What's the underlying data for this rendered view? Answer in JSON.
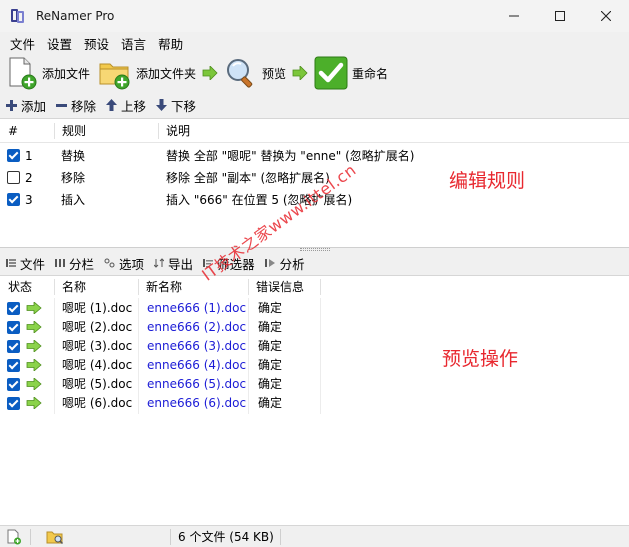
{
  "window": {
    "title": "ReNamer Pro",
    "controls": [
      "minimize",
      "maximize",
      "close"
    ]
  },
  "menu": [
    "文件",
    "设置",
    "预设",
    "语言",
    "帮助"
  ],
  "toolbar": {
    "add_files": "添加文件",
    "add_folders": "添加文件夹",
    "preview": "预览",
    "rename": "重命名"
  },
  "rules_actions": {
    "add": "添加",
    "remove": "移除",
    "up": "上移",
    "down": "下移"
  },
  "rules_table": {
    "columns": [
      "#",
      "规则",
      "说明"
    ],
    "rows": [
      {
        "checked": true,
        "num": "1",
        "rule": "替换",
        "desc": "替换 全部 \"嗯呢\" 替换为 \"enne\" (忽略扩展名)"
      },
      {
        "checked": false,
        "num": "2",
        "rule": "移除",
        "desc": "移除 全部 \"副本\" (忽略扩展名)"
      },
      {
        "checked": true,
        "num": "3",
        "rule": "插入",
        "desc": "插入 \"666\" 在位置 5 (忽略扩展名)"
      }
    ]
  },
  "files_toolbar": [
    "文件",
    "分栏",
    "选项",
    "导出",
    "筛选器",
    "分析"
  ],
  "files_table": {
    "columns": [
      "状态",
      "名称",
      "新名称",
      "错误信息"
    ],
    "rows": [
      {
        "checked": true,
        "name": "嗯呢 (1).doc",
        "new_name": "enne666 (1).doc",
        "error": "确定"
      },
      {
        "checked": true,
        "name": "嗯呢 (2).doc",
        "new_name": "enne666 (2).doc",
        "error": "确定"
      },
      {
        "checked": true,
        "name": "嗯呢 (3).doc",
        "new_name": "enne666 (3).doc",
        "error": "确定"
      },
      {
        "checked": true,
        "name": "嗯呢 (4).doc",
        "new_name": "enne666 (4).doc",
        "error": "确定"
      },
      {
        "checked": true,
        "name": "嗯呢 (5).doc",
        "new_name": "enne666 (5).doc",
        "error": "确定"
      },
      {
        "checked": true,
        "name": "嗯呢 (6).doc",
        "new_name": "enne666 (6).doc",
        "error": "确定"
      }
    ]
  },
  "annotations": {
    "rules": "编辑规则",
    "preview": "预览操作",
    "watermark": "IT技术之家www.ittel.cn"
  },
  "status": {
    "summary": "6 个文件 (54 KB)"
  },
  "colors": {
    "checkbox": "#0a5dc2",
    "new_name": "#1b1bd6",
    "annotation": "#e8282f",
    "arrow_green": "#6cc21e"
  }
}
